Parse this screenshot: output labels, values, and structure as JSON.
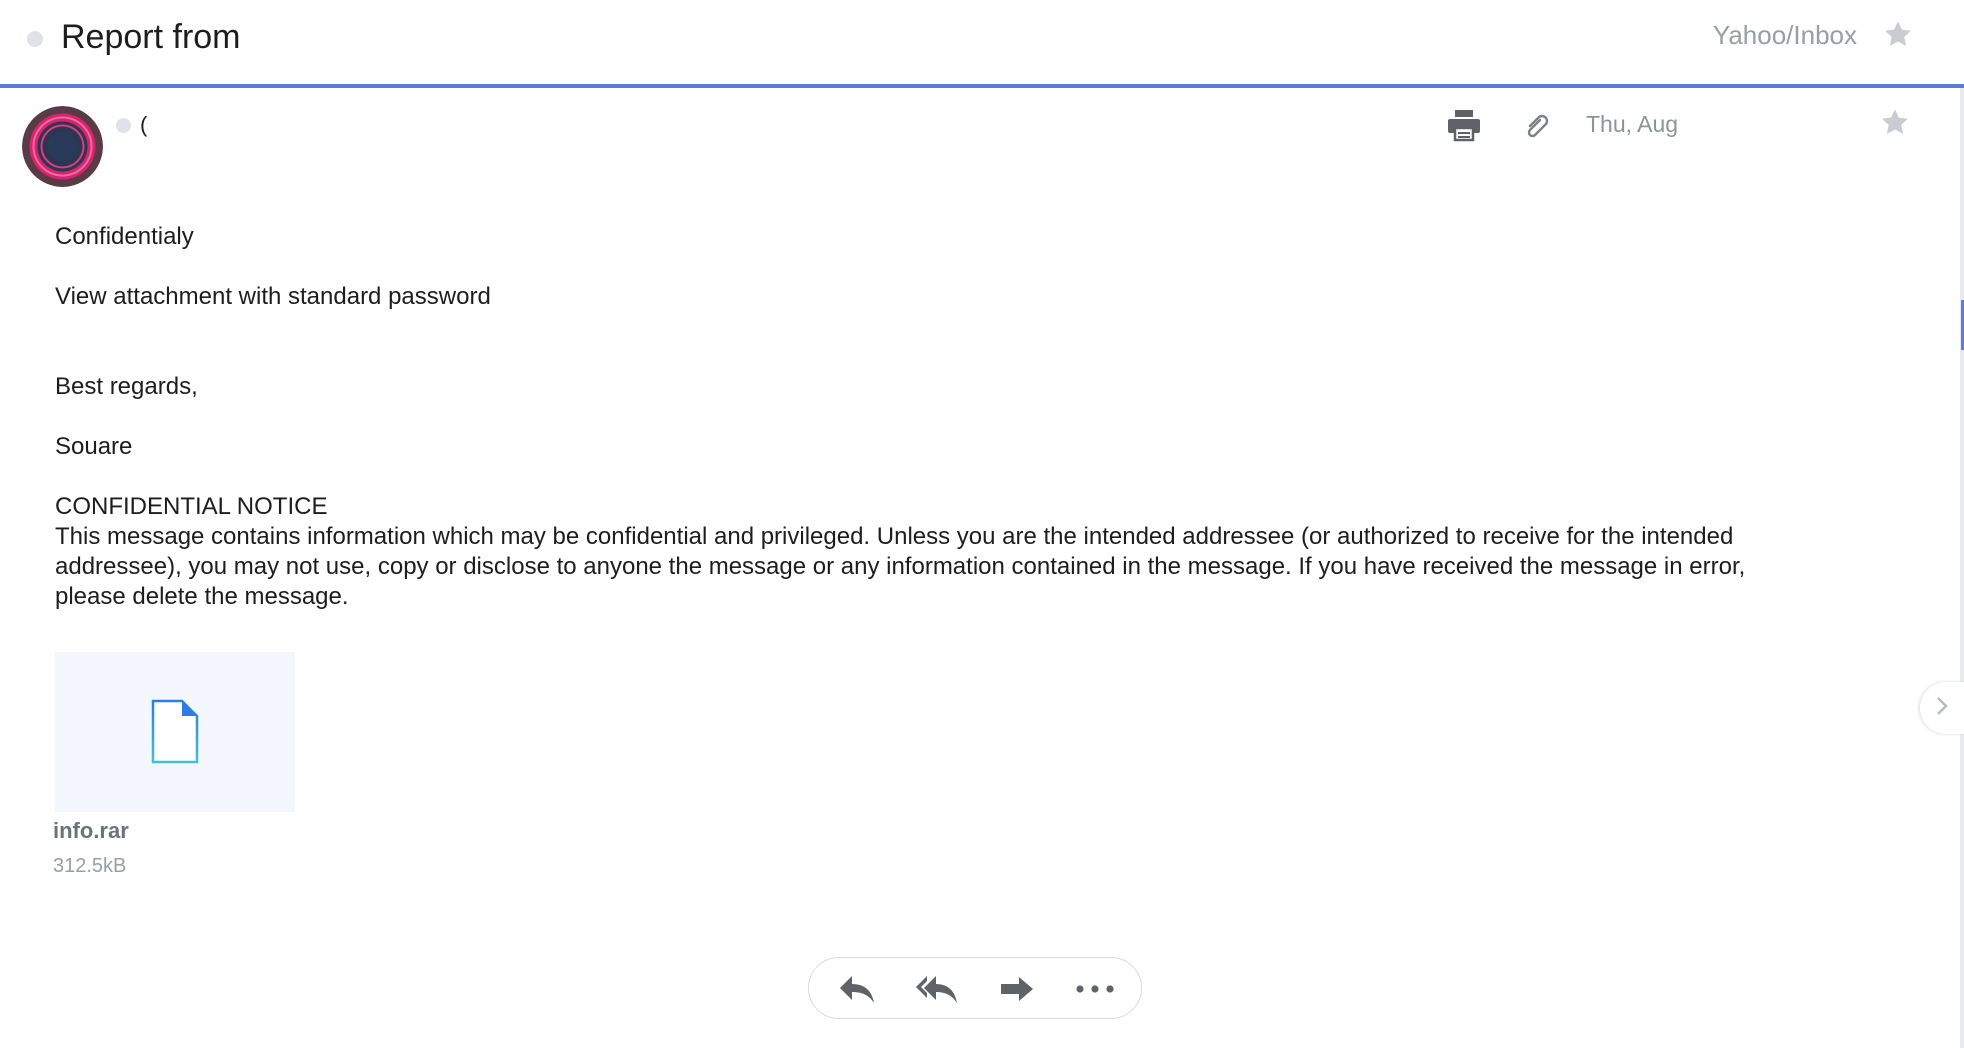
{
  "header": {
    "subject": "Report from",
    "folder": "Yahoo/Inbox"
  },
  "message": {
    "sender_initial": "(",
    "date": "Thu, Aug",
    "body": {
      "line1": "Confidentialy",
      "line2": "View attachment with standard password",
      "closing": "Best regards,",
      "signature": "Souare",
      "notice_title": "CONFIDENTIAL NOTICE",
      "notice_text": "This message contains information which may be confidential and privileged. Unless you are the intended addressee (or authorized to receive for the intended addressee), you may not use, copy or disclose to anyone the message or any information contained in the message. If you have received the message in error, please delete the message."
    },
    "attachment": {
      "name": "info.rar",
      "size": "312.5kB"
    }
  },
  "icons": {
    "star": "star-icon",
    "print": "print-icon",
    "attachment": "paperclip-icon",
    "file": "file-icon",
    "reply": "reply-icon",
    "reply_all": "reply-all-icon",
    "forward": "forward-icon",
    "more": "more-icon",
    "next": "chevron-right-icon"
  },
  "colors": {
    "accent": "#5a7fd8",
    "file_icon": "#2f7de1",
    "muted_text": "#9a9da3",
    "icon_gray": "#5f6368"
  }
}
